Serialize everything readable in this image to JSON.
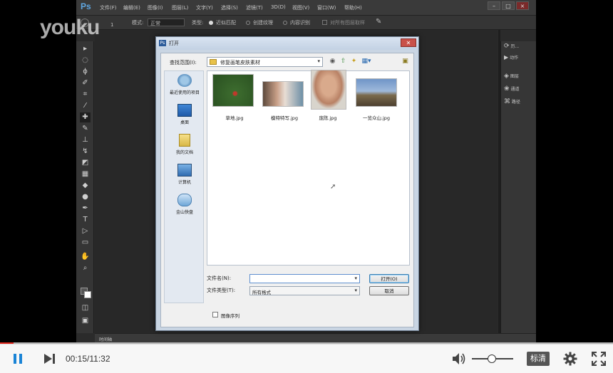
{
  "photoshop": {
    "logo": "Ps",
    "menu": [
      "文件(F)",
      "编辑(E)",
      "图像(I)",
      "图层(L)",
      "文字(Y)",
      "选择(S)",
      "滤镜(T)",
      "3D(D)",
      "视图(V)",
      "窗口(W)",
      "帮助(H)"
    ],
    "options": {
      "brush_size": "1",
      "mode_label": "模式:",
      "mode_value": "正常",
      "type_label": "类型:",
      "type_options": [
        "近似匹配",
        "创建纹理",
        "内容识别"
      ],
      "sample_all_layers": "对所有图层取样"
    },
    "right_panel": [
      "历...",
      "动作",
      "图层",
      "通道",
      "路径"
    ],
    "status_tab": "时间轴"
  },
  "watermark": "youku",
  "dialog": {
    "title": "打开",
    "look_in_label": "查找范围(I):",
    "current_folder": "修复画笔皮肤素材",
    "places": [
      "最近使用的项目",
      "桌面",
      "我的文档",
      "计算机",
      "金山快盘"
    ],
    "files": [
      {
        "name": "草地.jpg",
        "thumb_color": "#3c6b2e"
      },
      {
        "name": "模特特写.jpg",
        "thumb_color": "#6d8fa6"
      },
      {
        "name": "庞陈.jpg",
        "thumb_color": "#c7987c"
      },
      {
        "name": "一览众山.jpg",
        "thumb_color": "#4a6c9a"
      }
    ],
    "filename_label": "文件名(N):",
    "filename_value": "",
    "filetype_label": "文件类型(T):",
    "filetype_value": "所有格式",
    "open_button": "打开(O)",
    "cancel_button": "取消",
    "image_sequence_label": "图像序列"
  },
  "player": {
    "current_time": "00:15",
    "duration": "11:32",
    "time_display": "00:15/11:32",
    "progress_fraction": 0.022,
    "volume_fraction": 0.5,
    "quality_label": "标清",
    "accent_color": "#e1261c"
  }
}
